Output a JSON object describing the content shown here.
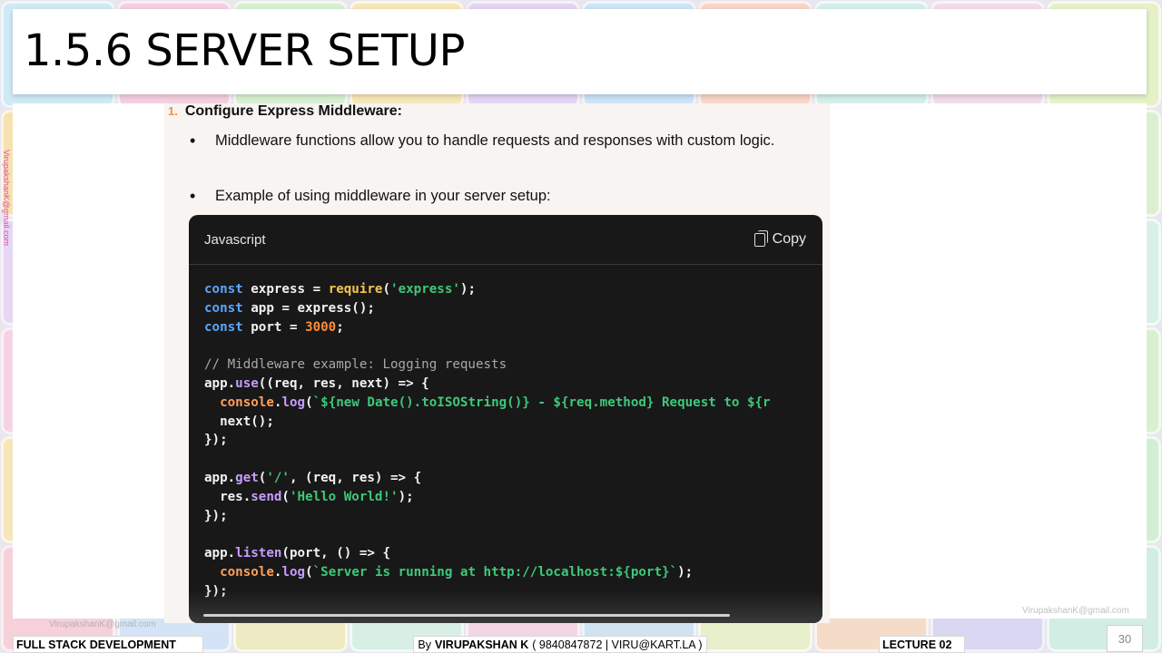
{
  "slide": {
    "title": "1.5.6 SERVER SETUP",
    "side_email": "VirupakshanK@gmail.com",
    "watermark_email": "VirupakshanK@gmail.com"
  },
  "content": {
    "step_number": "1.",
    "step_title": "Configure Express Middleware:",
    "bullets": [
      "Middleware functions allow you to handle requests and responses with custom logic.",
      "Example of using middleware in your server setup:"
    ],
    "code": {
      "language": "Javascript",
      "copy_label": "Copy",
      "lines": [
        "const express = require('express');",
        "const app = express();",
        "const port = 3000;",
        "",
        "// Middleware example: Logging requests",
        "app.use((req, res, next) => {",
        "  console.log(`${new Date().toISOString()} - ${req.method} Request to ${r",
        "  next();",
        "});",
        "",
        "app.get('/', (req, res) => {",
        "  res.send('Hello World!');",
        "});",
        "",
        "app.listen(port, () => {",
        "  console.log(`Server is running at http://localhost:${port}`);",
        "});"
      ]
    }
  },
  "footer": {
    "course": "FULL STACK DEVELOPMENT",
    "by_prefix": "By",
    "author": "VIRUPAKSHAN K",
    "contact": "( 9840847872 | VIRU@KART.LA )",
    "lecture": "LECTURE 02",
    "page_number": "30"
  },
  "colors": {
    "keyword": "#5aa7ff",
    "function": "#f6c54d",
    "string": "#3fc879",
    "number": "#ff8a3a",
    "comment": "#a8a8a8",
    "code_background": "#181818"
  },
  "background_tiles": [
    "#cfe9f5",
    "#f3cfe0",
    "#d7f0d2",
    "#f6e7b8",
    "#e3d4f3",
    "#cde4f7",
    "#f7d5c8",
    "#d4efe9",
    "#f2dceb",
    "#e6f1c9",
    "#f6e2b0",
    "#cfe0f7",
    "#f3d0d0",
    "#d8f0dc",
    "#ead8f5",
    "#cdebf3",
    "#f7e1c8",
    "#d7e7f7",
    "#f1d2e6",
    "#dcefd0",
    "#e7d6f4",
    "#f6d9c3",
    "#cfeaf0",
    "#f4e6b8",
    "#dfd5f3",
    "#d0efd9",
    "#f5cfdb",
    "#d6e6f6",
    "#f1e7c2",
    "#d9f0e6",
    "#f4d4e4",
    "#cde5f4",
    "#e9f1c8",
    "#f6dbc9",
    "#d7d5f3",
    "#cfeee4",
    "#f3d2cf",
    "#dbe8f6",
    "#f1e0f0",
    "#d8f0cf",
    "#f6e6b9",
    "#d0e1f6",
    "#efd3e7",
    "#d6efe0",
    "#f4d8c6",
    "#dcd6f2",
    "#cfe8f1",
    "#f4e3bd",
    "#e2d7f4",
    "#d2efd6",
    "#f6d1d9",
    "#d4e4f6",
    "#eeeac4",
    "#d8efe6",
    "#f3d6e3",
    "#cfe3f2",
    "#e7efcb",
    "#f5dcc9",
    "#dad7f2",
    "#d2ede4"
  ]
}
